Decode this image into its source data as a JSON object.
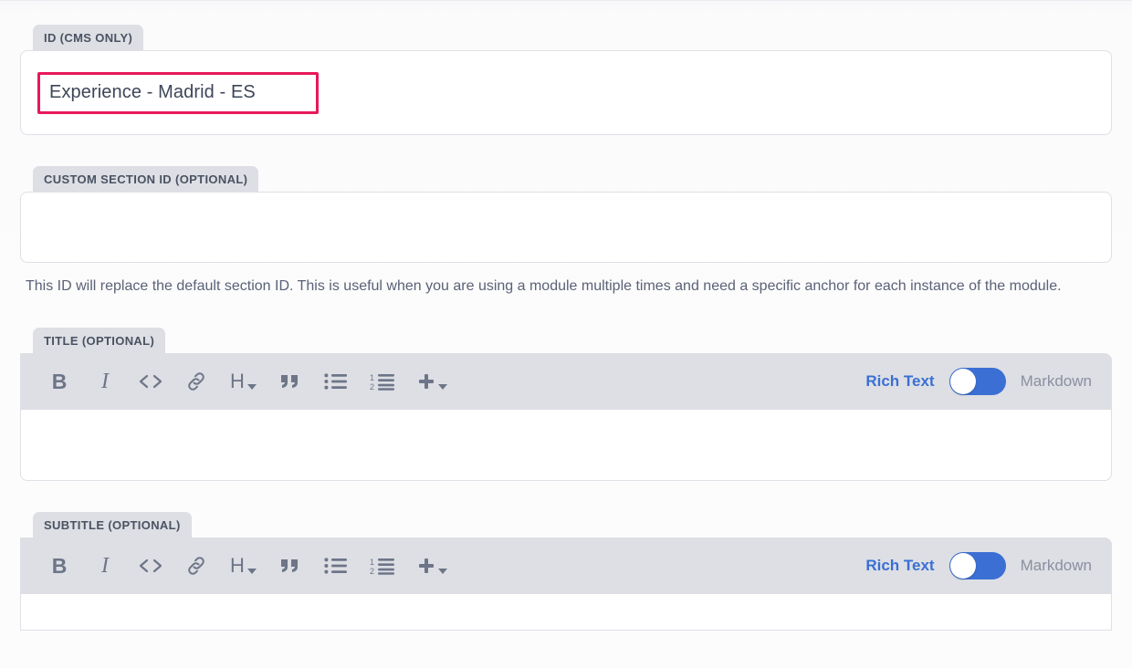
{
  "theme": {
    "accent_blue": "#3b6fd4",
    "highlight_pink": "#e8185b",
    "label_bg": "#dddfe4",
    "text_muted": "#5b6276"
  },
  "fields": [
    {
      "id": "cms_id",
      "label": "ID (CMS ONLY)",
      "value": "Experience - Madrid - ES",
      "placeholder": "",
      "highlighted": true
    },
    {
      "id": "custom_section_id",
      "label": "CUSTOM SECTION ID (OPTIONAL)",
      "value": "",
      "placeholder": "",
      "highlighted": false,
      "help_text": "This ID will replace the default section ID. This is useful when you are using a module multiple times and need a specific anchor for each instance of the module."
    }
  ],
  "editors": [
    {
      "id": "title",
      "label": "TITLE (OPTIONAL)",
      "value": "",
      "mode": {
        "left_label": "Rich Text",
        "right_label": "Markdown",
        "active": "Rich Text"
      }
    },
    {
      "id": "subtitle",
      "label": "SUBTITLE (OPTIONAL)",
      "value": "",
      "mode": {
        "left_label": "Rich Text",
        "right_label": "Markdown",
        "active": "Rich Text"
      }
    }
  ],
  "toolbar": {
    "items": [
      {
        "name": "bold-icon",
        "glyph": "B",
        "title": "Bold"
      },
      {
        "name": "italic-icon",
        "glyph": "I",
        "title": "Italic"
      },
      {
        "name": "code-icon",
        "glyph": "<>",
        "title": "Code"
      },
      {
        "name": "link-icon",
        "glyph": "link",
        "title": "Link"
      },
      {
        "name": "heading-icon",
        "glyph": "H",
        "title": "Heading"
      },
      {
        "name": "blockquote-icon",
        "glyph": "”",
        "title": "Blockquote"
      },
      {
        "name": "bulleted-list-icon",
        "glyph": "ul",
        "title": "Bulleted list"
      },
      {
        "name": "numbered-list-icon",
        "glyph": "ol",
        "title": "Numbered list"
      },
      {
        "name": "add-icon",
        "glyph": "+",
        "title": "Insert"
      }
    ]
  }
}
